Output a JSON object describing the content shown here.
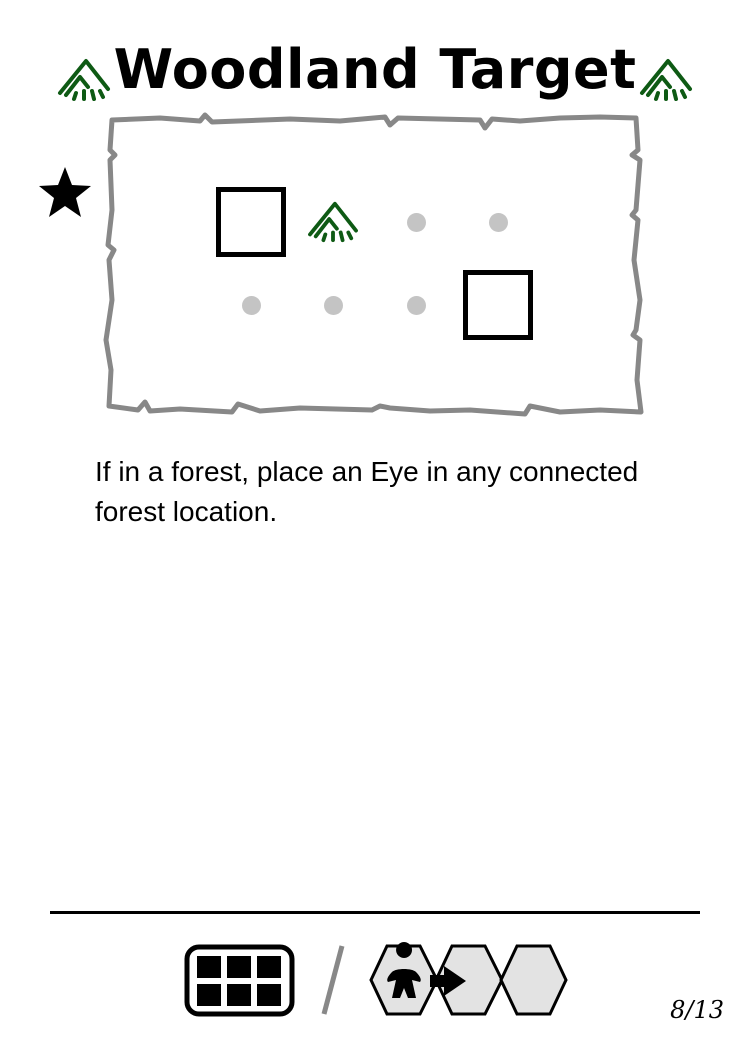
{
  "card": {
    "title": "Woodland Target",
    "ability_text": "If in a forest, place an Eye in any connected forest location.",
    "page_number": "8/13"
  },
  "icons": {
    "title_left": "forest-icon",
    "title_right": "forest-icon",
    "marker": "star-icon",
    "footer_left": "grid-icon",
    "footer_separator": "slash",
    "footer_right": "meeple-move-hex-icon"
  },
  "board_pattern": {
    "rows": [
      [
        "empty",
        "square",
        "forest",
        "dot",
        "dot"
      ],
      [
        "empty",
        "dot",
        "dot",
        "dot",
        "square"
      ]
    ]
  },
  "colors": {
    "forest": "#0e5a14",
    "frame": "#808080",
    "dot": "#c4c4c4",
    "hex_fill": "#e3e3e3"
  }
}
